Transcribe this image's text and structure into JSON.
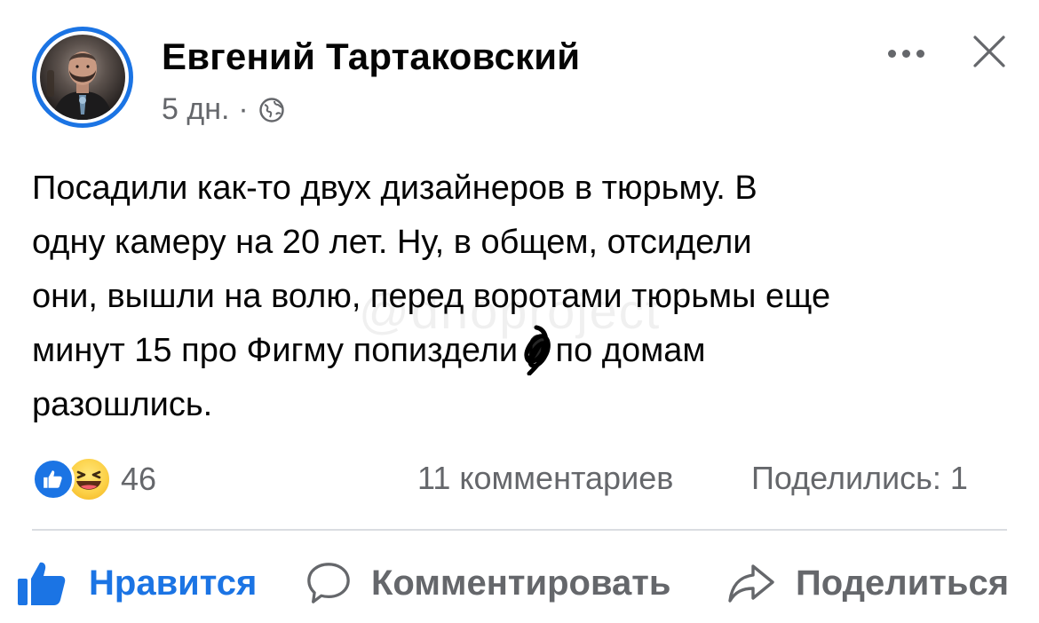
{
  "post": {
    "author": "Евгений Тартаковский",
    "time": "5 дн.",
    "separator": "·",
    "text": "Посадили как-то двух дизайнеров в тюрьму. В\nодну камеру на 20 лет. Ну, в общем, отсидели\nони, вышли на волю, перед воротами тюрьмы еще\nминут 15 про Фигму попиздели и по домам\nразошлись.",
    "watermark": "@dnoproject"
  },
  "stats": {
    "reactions": "46",
    "comments": "11 комментариев",
    "shares": "Поделились: 1"
  },
  "actions": {
    "like": "Нравится",
    "comment": "Комментировать",
    "share": "Поделиться"
  },
  "icons": {
    "more": "more-dots-icon",
    "close": "close-x-icon",
    "audience": "globe-icon",
    "like_reaction": "like-reaction-icon",
    "haha_reaction": "haha-reaction-icon",
    "like_action": "thumbs-up-icon",
    "comment_action": "speech-bubble-icon",
    "share_action": "share-arrow-icon"
  },
  "colors": {
    "accent": "#1b74e4",
    "text_primary": "#050505",
    "text_secondary": "#65676b",
    "divider": "#dadde1",
    "haha_yellow": "#fcd148"
  }
}
